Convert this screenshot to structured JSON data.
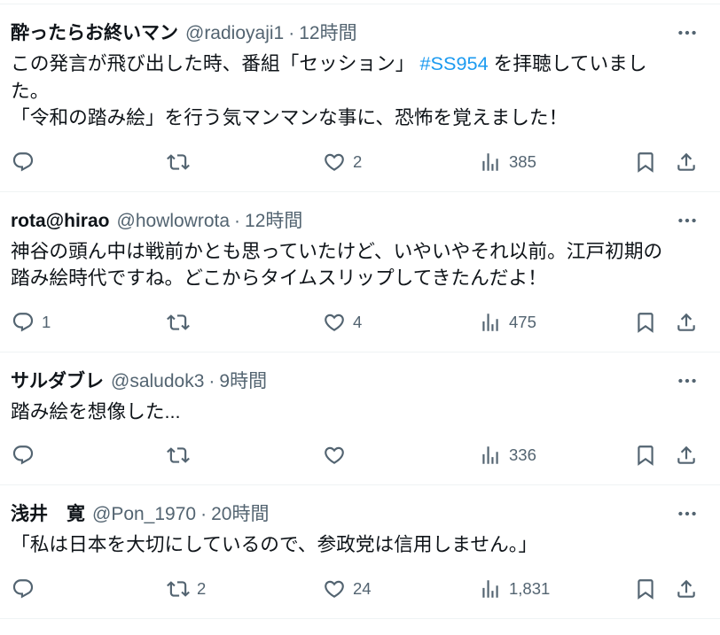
{
  "colors": {
    "text": "#0f1419",
    "secondary": "#536471",
    "hashtag": "#1d9bf0",
    "divider": "#eff3f4",
    "background": "#ffffff"
  },
  "icons": {
    "reply": "reply-icon",
    "retweet": "retweet-icon",
    "like": "heart-icon",
    "views": "views-icon",
    "bookmark": "bookmark-icon",
    "share": "share-icon",
    "more": "more-icon"
  },
  "tweets": [
    {
      "name": "酔ったらお終いマン",
      "handle": "@radioyaji1",
      "dot": "·",
      "time": "12時間",
      "body": [
        [
          "この発言が飛び出した時、番組「セッション」 ",
          "#SS954",
          " を拝聴していまし"
        ],
        [
          "た。"
        ],
        [
          "「令和の踏み絵」を行う気マンマンな事に、恐怖を覚えました！"
        ]
      ],
      "counts": {
        "like": "2",
        "views": "385"
      }
    },
    {
      "name": "rota@hirao",
      "handle": "@howlowrota",
      "dot": "·",
      "time": "12時間",
      "body": [
        [
          "神谷の頭ん中は戦前かとも思っていたけど、いやいやそれ以前。江戸初期の"
        ],
        [
          "踏み絵時代ですね。どこからタイムスリップしてきたんだよ！"
        ]
      ],
      "counts": {
        "reply": "1",
        "like": "4",
        "views": "475"
      }
    },
    {
      "name": "サルダブレ",
      "handle": "@saludok3",
      "dot": "·",
      "time": "9時間",
      "body": [
        [
          "踏み絵を想像した..."
        ]
      ],
      "counts": {
        "views": "336"
      }
    },
    {
      "name": "浅井　寛",
      "handle": "@Pon_1970",
      "dot": "·",
      "time": "20時間",
      "body": [
        [
          "「私は日本を大切にしているので、参政党は信用しません。」"
        ]
      ],
      "counts": {
        "retweet": "2",
        "like": "24",
        "views": "1,831"
      }
    }
  ]
}
